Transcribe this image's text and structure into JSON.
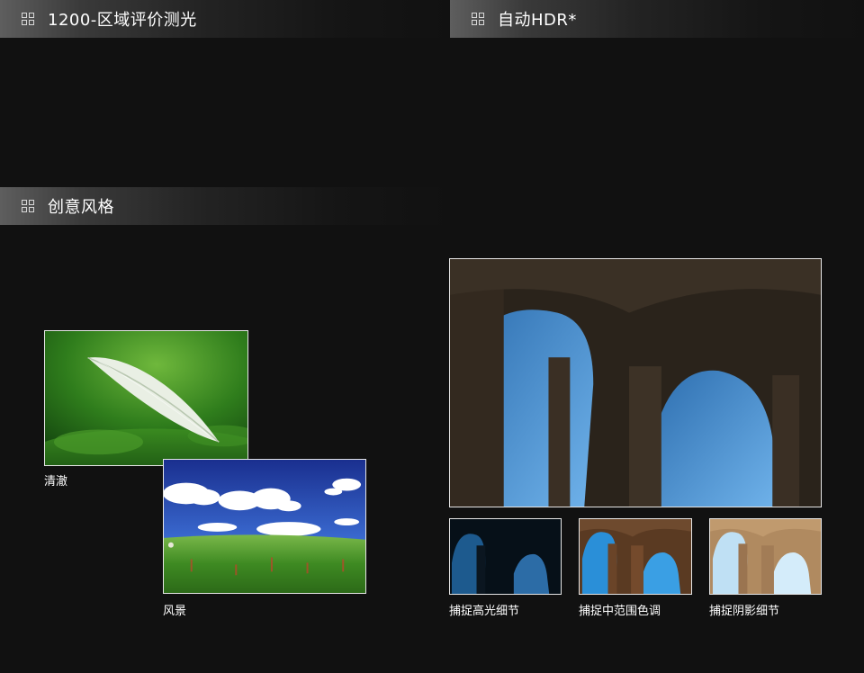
{
  "sections": {
    "metering": {
      "title": "1200-区域评价测光",
      "icon": "grid-icon"
    },
    "hdr": {
      "title": "自动HDR*",
      "icon": "grid-icon"
    },
    "creative": {
      "title": "创意风格",
      "icon": "grid-icon"
    }
  },
  "creative_photos": {
    "clear": {
      "caption": "清澈"
    },
    "landscape": {
      "caption": "风景"
    }
  },
  "hdr_photos": {
    "highlight": {
      "caption": "捕捉高光细节"
    },
    "midrange": {
      "caption": "捕捉中范围色调"
    },
    "shadow": {
      "caption": "捕捉阴影细节"
    }
  },
  "colors": {
    "background": "#111111",
    "border": "#e6e6e6"
  }
}
